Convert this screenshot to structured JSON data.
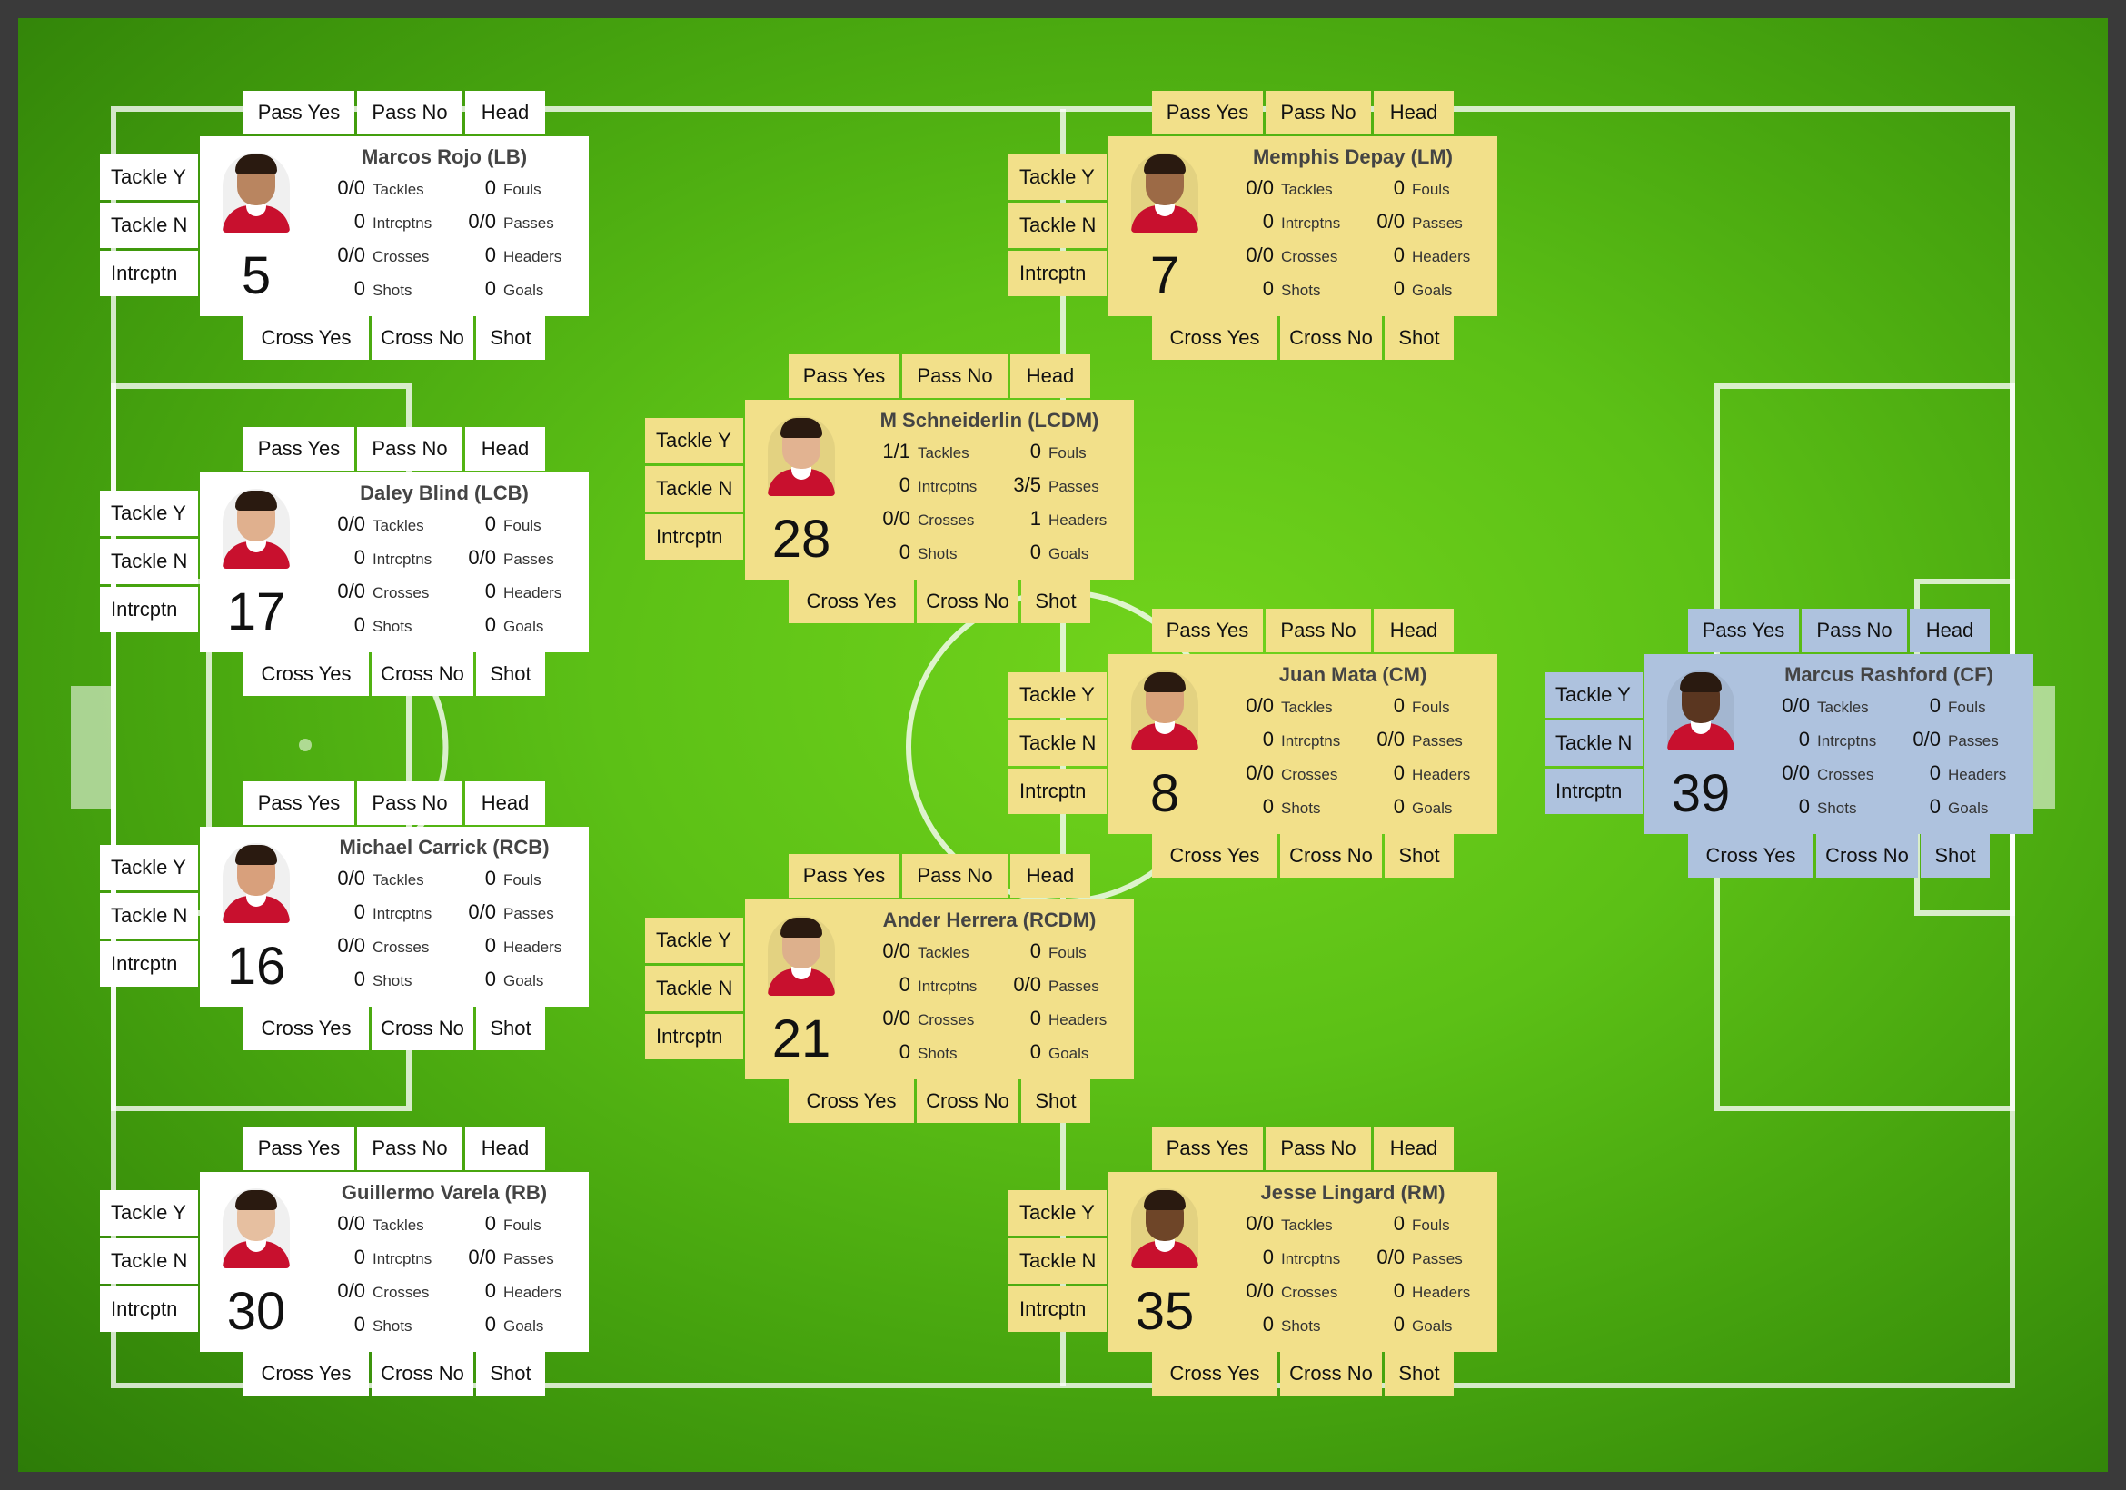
{
  "players": [
    {
      "name": "Marcos Rojo (LB)",
      "number": "5",
      "theme": "white",
      "stats": {
        "tackles": "0/0",
        "fouls": "0",
        "intrcptns": "0",
        "passes": "0/0",
        "crosses": "0/0",
        "headers": "0",
        "shots": "0",
        "goals": "0"
      }
    },
    {
      "name": "Daley Blind (LCB)",
      "number": "17",
      "theme": "white",
      "stats": {
        "tackles": "0/0",
        "fouls": "0",
        "intrcptns": "0",
        "passes": "0/0",
        "crosses": "0/0",
        "headers": "0",
        "shots": "0",
        "goals": "0"
      }
    },
    {
      "name": "Michael Carrick (RCB)",
      "number": "16",
      "theme": "white",
      "stats": {
        "tackles": "0/0",
        "fouls": "0",
        "intrcptns": "0",
        "passes": "0/0",
        "crosses": "0/0",
        "headers": "0",
        "shots": "0",
        "goals": "0"
      }
    },
    {
      "name": "Guillermo Varela (RB)",
      "number": "30",
      "theme": "white",
      "stats": {
        "tackles": "0/0",
        "fouls": "0",
        "intrcptns": "0",
        "passes": "0/0",
        "crosses": "0/0",
        "headers": "0",
        "shots": "0",
        "goals": "0"
      }
    },
    {
      "name": "M Schneiderlin (LCDM)",
      "number": "28",
      "theme": "yellow",
      "stats": {
        "tackles": "1/1",
        "fouls": "0",
        "intrcptns": "0",
        "passes": "3/5",
        "crosses": "0/0",
        "headers": "1",
        "shots": "0",
        "goals": "0"
      }
    },
    {
      "name": "Ander Herrera (RCDM)",
      "number": "21",
      "theme": "yellow",
      "stats": {
        "tackles": "0/0",
        "fouls": "0",
        "intrcptns": "0",
        "passes": "0/0",
        "crosses": "0/0",
        "headers": "0",
        "shots": "0",
        "goals": "0"
      }
    },
    {
      "name": "Memphis Depay (LM)",
      "number": "7",
      "theme": "yellow",
      "stats": {
        "tackles": "0/0",
        "fouls": "0",
        "intrcptns": "0",
        "passes": "0/0",
        "crosses": "0/0",
        "headers": "0",
        "shots": "0",
        "goals": "0"
      }
    },
    {
      "name": "Juan Mata (CM)",
      "number": "8",
      "theme": "yellow",
      "stats": {
        "tackles": "0/0",
        "fouls": "0",
        "intrcptns": "0",
        "passes": "0/0",
        "crosses": "0/0",
        "headers": "0",
        "shots": "0",
        "goals": "0"
      }
    },
    {
      "name": "Jesse Lingard (RM)",
      "number": "35",
      "theme": "yellow",
      "stats": {
        "tackles": "0/0",
        "fouls": "0",
        "intrcptns": "0",
        "passes": "0/0",
        "crosses": "0/0",
        "headers": "0",
        "shots": "0",
        "goals": "0"
      }
    },
    {
      "name": "Marcus Rashford (CF)",
      "number": "39",
      "theme": "blue",
      "stats": {
        "tackles": "0/0",
        "fouls": "0",
        "intrcptns": "0",
        "passes": "0/0",
        "crosses": "0/0",
        "headers": "0",
        "shots": "0",
        "goals": "0"
      }
    }
  ],
  "buttons": {
    "pass_yes": "Pass Yes",
    "pass_no": "Pass No",
    "head": "Head",
    "tackle_y": "Tackle Y",
    "tackle_n": "Tackle N",
    "intrcptn": "Intrcptn",
    "cross_yes": "Cross Yes",
    "cross_no": "Cross No",
    "shot": "Shot"
  },
  "stat_labels": {
    "tackles": "Tackles",
    "fouls": "Fouls",
    "intrcptns": "Intrcptns",
    "passes": "Passes",
    "crosses": "Crosses",
    "headers": "Headers",
    "shots": "Shots",
    "goals": "Goals"
  },
  "colors": {
    "white": "#ffffff",
    "yellow": "#f2e08a",
    "blue": "#aec2de",
    "pitch": "#5cc016"
  }
}
